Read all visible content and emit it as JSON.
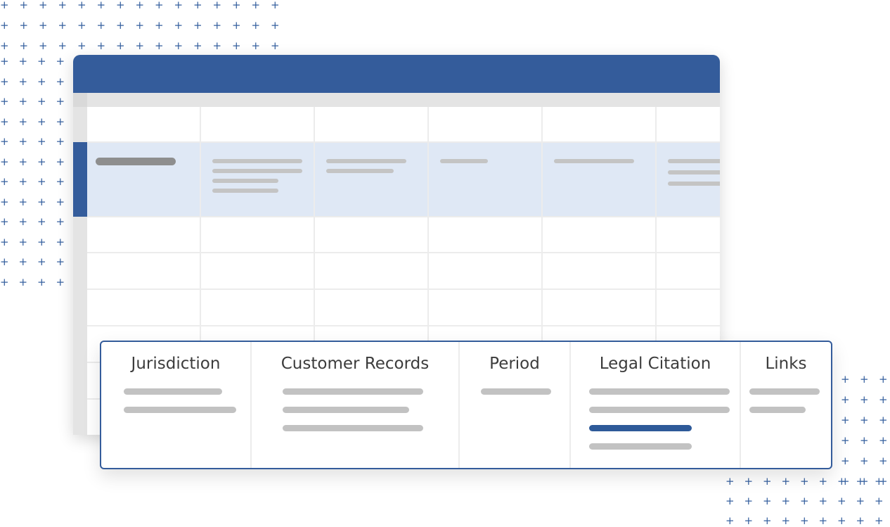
{
  "card": {
    "columns": [
      {
        "title": "Jurisdiction"
      },
      {
        "title": "Customer Records"
      },
      {
        "title": "Period"
      },
      {
        "title": "Legal Citation"
      },
      {
        "title": "Links"
      }
    ]
  },
  "colors": {
    "accent": "#345c9b",
    "highlight_row": "#dfe8f5",
    "plus_marks": "#345f9e"
  },
  "icons": [
    "plus-icon"
  ]
}
